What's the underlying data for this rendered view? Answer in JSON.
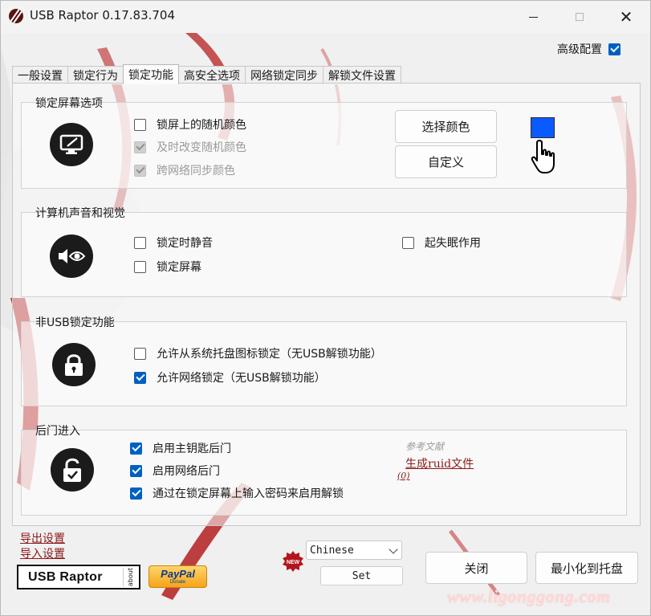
{
  "window": {
    "title": "USB Raptor 0.17.83.704",
    "minimize": "—",
    "maximize": "",
    "close": "✕"
  },
  "advanced": {
    "label": "高级配置",
    "checked": true
  },
  "tabs": [
    {
      "label": "一般设置",
      "active": false
    },
    {
      "label": "锁定行为",
      "active": false
    },
    {
      "label": "锁定功能",
      "active": true
    },
    {
      "label": "高安全选项",
      "active": false
    },
    {
      "label": "网络锁定同步",
      "active": false
    },
    {
      "label": "解锁文件设置",
      "active": false
    }
  ],
  "lockscreen": {
    "title": "锁定屏幕选项",
    "options": [
      {
        "label": "锁屏上的随机颜色",
        "checked": false,
        "enabled": true
      },
      {
        "label": "及时改变随机颜色",
        "checked": true,
        "enabled": false
      },
      {
        "label": "跨网络同步颜色",
        "checked": true,
        "enabled": false
      }
    ],
    "choose_color": "选择颜色",
    "custom": "自定义",
    "swatch_color": "#0a5bff"
  },
  "sound": {
    "title": "计算机声音和视觉",
    "options": [
      {
        "label": "锁定时静音",
        "checked": false
      },
      {
        "label": "锁定屏幕",
        "checked": false
      },
      {
        "label": "起失眠作用",
        "checked": false
      }
    ]
  },
  "nonusb": {
    "title": "非USB锁定功能",
    "options": [
      {
        "label": "允许从系统托盘图标锁定（无USB解锁功能）",
        "checked": false
      },
      {
        "label": "允许网络锁定（无USB解锁功能）",
        "checked": true
      }
    ]
  },
  "backdoor": {
    "title": "后门进入",
    "options": [
      {
        "label": "启用主钥匙后门",
        "checked": true
      },
      {
        "label": "启用网络后门",
        "checked": true
      },
      {
        "label": "通过在锁定屏幕上输入密码来启用解锁",
        "checked": true
      }
    ],
    "ref_doc": "参考文献",
    "gen_ruid": "生成ruid文件",
    "count": "(0)"
  },
  "footer": {
    "export": "导出设置",
    "import": "导入设置",
    "logo": "USB Raptor",
    "about": "about",
    "paypal": "PayPal",
    "donate": "Donate",
    "new_badge": "NEW",
    "language": "Chinese",
    "set": "Set",
    "close": "关闭",
    "minimize_tray": "最小化到托盘"
  },
  "watermark": "www.ligonggong.com"
}
